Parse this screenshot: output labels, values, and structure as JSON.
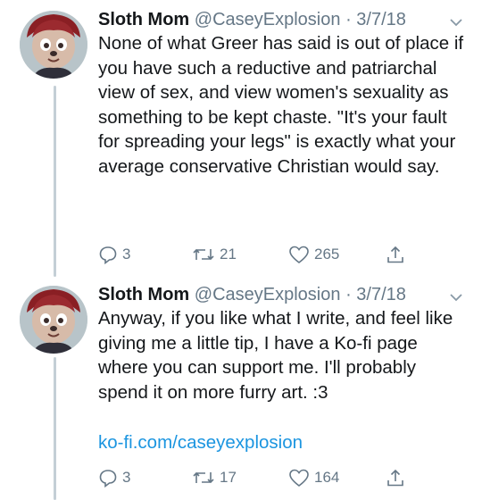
{
  "tweets": [
    {
      "name": "Sloth Mom",
      "handle": "@CaseyExplosion",
      "separator": "·",
      "date": "3/7/18",
      "text": "None of what Greer has said is out of place if you have such a reductive and patriarchal view of sex, and view women's sexuality as something to be kept chaste. \"It's your fault for spreading your legs\" is exactly what your average conservative Christian would say.",
      "link": "",
      "replies": "3",
      "retweets": "21",
      "likes": "265"
    },
    {
      "name": "Sloth Mom",
      "handle": "@CaseyExplosion",
      "separator": "·",
      "date": "3/7/18",
      "text": "Anyway, if you like what I write, and feel like giving me a little tip, I have a Ko-fi page where you can support me. I'll probably spend it on more furry art. :3",
      "link": "ko-fi.com/caseyexplosion",
      "replies": "3",
      "retweets": "17",
      "likes": "164"
    }
  ],
  "icons": {
    "avatar": "furry-character-avatar",
    "menu": "chevron-down-icon",
    "reply": "reply-icon",
    "retweet": "retweet-icon",
    "like": "heart-icon",
    "share": "share-icon"
  },
  "colors": {
    "text": "#14171a",
    "secondary": "#657786",
    "link": "#1b95e0",
    "thread_line": "#c4cfd6"
  }
}
